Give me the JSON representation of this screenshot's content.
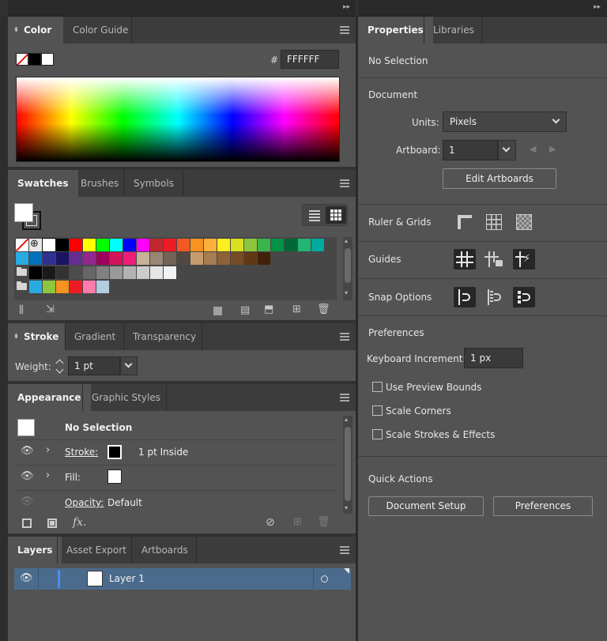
{
  "color_panel": {
    "tabs": [
      "Color",
      "Color Guide"
    ],
    "hash": "#",
    "hex_value": "FFFFFF"
  },
  "swatches_panel": {
    "tabs": [
      "Swatches",
      "Brushes",
      "Symbols"
    ],
    "row1": [
      "#ffffff",
      "#000000",
      "#ff0000",
      "#ffff00",
      "#00ff00",
      "#00ffff",
      "#0000ff",
      "#ff00ff",
      "#c1272d",
      "#ed1c24",
      "#f15a24",
      "#f7931e",
      "#fbb03b",
      "#fcee21",
      "#d9e021",
      "#8cc63f",
      "#39b54a",
      "#009245",
      "#006837",
      "#22b573",
      "#00a99d"
    ],
    "row2": [
      "#29abe2",
      "#0071bc",
      "#2e3192",
      "#1b1464",
      "#662d91",
      "#93278f",
      "#9e005d",
      "#d4145a",
      "#ed1e79",
      "#c7b299",
      "#998675",
      "#736357",
      "#534741",
      "#c69c6d",
      "#a67c52",
      "#8c6239",
      "#754c24",
      "#603813",
      "#42210b"
    ],
    "row3": [
      "#000000",
      "#1a1a1a",
      "#333333",
      "#4d4d4d",
      "#666666",
      "#808080",
      "#999999",
      "#b3b3b3",
      "#cccccc",
      "#e6e6e6",
      "#f2f2f2"
    ],
    "row4": [
      "#29abe2",
      "#8cc63f",
      "#f7931e",
      "#ed1c24",
      "#ff7bac",
      "#b3cde0"
    ]
  },
  "stroke_panel": {
    "tabs": [
      "Stroke",
      "Gradient",
      "Transparency"
    ],
    "weight_label": "Weight:",
    "weight_value": "1 pt"
  },
  "appearance_panel": {
    "tabs": [
      "Appearance",
      "Graphic Styles"
    ],
    "header": "No Selection",
    "stroke_label": "Stroke:",
    "stroke_value": "1 pt  Inside",
    "fill_label": "Fill:",
    "opacity_label": "Opacity:",
    "opacity_value": "Default",
    "fx_label": "fx."
  },
  "layers_panel": {
    "tabs": [
      "Layers",
      "Asset Export",
      "Artboards"
    ],
    "layer_name": "Layer 1"
  },
  "properties_panel": {
    "tabs": [
      "Properties",
      "Libraries"
    ],
    "no_selection": "No Selection",
    "document_heading": "Document",
    "units_label": "Units:",
    "units_value": "Pixels",
    "artboard_label": "Artboard:",
    "artboard_value": "1",
    "edit_artboards": "Edit Artboards",
    "ruler_grids": "Ruler & Grids",
    "guides": "Guides",
    "snap_options": "Snap Options",
    "preferences_heading": "Preferences",
    "keyboard_increment_label": "Keyboard Increment:",
    "keyboard_increment_value": "1 px",
    "use_preview_bounds": "Use Preview Bounds",
    "scale_corners": "Scale Corners",
    "scale_strokes_effects": "Scale Strokes & Effects",
    "quick_actions": "Quick Actions",
    "document_setup": "Document Setup",
    "preferences_button": "Preferences"
  }
}
